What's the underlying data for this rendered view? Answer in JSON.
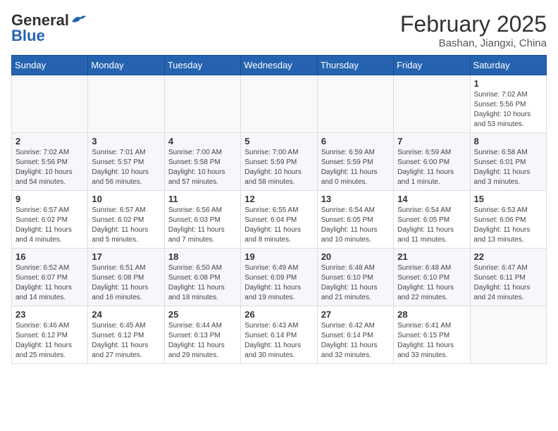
{
  "header": {
    "logo_general": "General",
    "logo_blue": "Blue",
    "month": "February 2025",
    "location": "Bashan, Jiangxi, China"
  },
  "weekdays": [
    "Sunday",
    "Monday",
    "Tuesday",
    "Wednesday",
    "Thursday",
    "Friday",
    "Saturday"
  ],
  "weeks": [
    [
      {
        "day": "",
        "info": ""
      },
      {
        "day": "",
        "info": ""
      },
      {
        "day": "",
        "info": ""
      },
      {
        "day": "",
        "info": ""
      },
      {
        "day": "",
        "info": ""
      },
      {
        "day": "",
        "info": ""
      },
      {
        "day": "1",
        "info": "Sunrise: 7:02 AM\nSunset: 5:56 PM\nDaylight: 10 hours and 53 minutes."
      }
    ],
    [
      {
        "day": "2",
        "info": "Sunrise: 7:02 AM\nSunset: 5:56 PM\nDaylight: 10 hours and 54 minutes."
      },
      {
        "day": "3",
        "info": "Sunrise: 7:01 AM\nSunset: 5:57 PM\nDaylight: 10 hours and 56 minutes."
      },
      {
        "day": "4",
        "info": "Sunrise: 7:00 AM\nSunset: 5:58 PM\nDaylight: 10 hours and 57 minutes."
      },
      {
        "day": "5",
        "info": "Sunrise: 7:00 AM\nSunset: 5:59 PM\nDaylight: 10 hours and 58 minutes."
      },
      {
        "day": "6",
        "info": "Sunrise: 6:59 AM\nSunset: 5:59 PM\nDaylight: 11 hours and 0 minutes."
      },
      {
        "day": "7",
        "info": "Sunrise: 6:59 AM\nSunset: 6:00 PM\nDaylight: 11 hours and 1 minute."
      },
      {
        "day": "8",
        "info": "Sunrise: 6:58 AM\nSunset: 6:01 PM\nDaylight: 11 hours and 3 minutes."
      }
    ],
    [
      {
        "day": "9",
        "info": "Sunrise: 6:57 AM\nSunset: 6:02 PM\nDaylight: 11 hours and 4 minutes."
      },
      {
        "day": "10",
        "info": "Sunrise: 6:57 AM\nSunset: 6:02 PM\nDaylight: 11 hours and 5 minutes."
      },
      {
        "day": "11",
        "info": "Sunrise: 6:56 AM\nSunset: 6:03 PM\nDaylight: 11 hours and 7 minutes."
      },
      {
        "day": "12",
        "info": "Sunrise: 6:55 AM\nSunset: 6:04 PM\nDaylight: 11 hours and 8 minutes."
      },
      {
        "day": "13",
        "info": "Sunrise: 6:54 AM\nSunset: 6:05 PM\nDaylight: 11 hours and 10 minutes."
      },
      {
        "day": "14",
        "info": "Sunrise: 6:54 AM\nSunset: 6:05 PM\nDaylight: 11 hours and 11 minutes."
      },
      {
        "day": "15",
        "info": "Sunrise: 6:53 AM\nSunset: 6:06 PM\nDaylight: 11 hours and 13 minutes."
      }
    ],
    [
      {
        "day": "16",
        "info": "Sunrise: 6:52 AM\nSunset: 6:07 PM\nDaylight: 11 hours and 14 minutes."
      },
      {
        "day": "17",
        "info": "Sunrise: 6:51 AM\nSunset: 6:08 PM\nDaylight: 11 hours and 16 minutes."
      },
      {
        "day": "18",
        "info": "Sunrise: 6:50 AM\nSunset: 6:08 PM\nDaylight: 11 hours and 18 minutes."
      },
      {
        "day": "19",
        "info": "Sunrise: 6:49 AM\nSunset: 6:09 PM\nDaylight: 11 hours and 19 minutes."
      },
      {
        "day": "20",
        "info": "Sunrise: 6:48 AM\nSunset: 6:10 PM\nDaylight: 11 hours and 21 minutes."
      },
      {
        "day": "21",
        "info": "Sunrise: 6:48 AM\nSunset: 6:10 PM\nDaylight: 11 hours and 22 minutes."
      },
      {
        "day": "22",
        "info": "Sunrise: 6:47 AM\nSunset: 6:11 PM\nDaylight: 11 hours and 24 minutes."
      }
    ],
    [
      {
        "day": "23",
        "info": "Sunrise: 6:46 AM\nSunset: 6:12 PM\nDaylight: 11 hours and 25 minutes."
      },
      {
        "day": "24",
        "info": "Sunrise: 6:45 AM\nSunset: 6:12 PM\nDaylight: 11 hours and 27 minutes."
      },
      {
        "day": "25",
        "info": "Sunrise: 6:44 AM\nSunset: 6:13 PM\nDaylight: 11 hours and 29 minutes."
      },
      {
        "day": "26",
        "info": "Sunrise: 6:43 AM\nSunset: 6:14 PM\nDaylight: 11 hours and 30 minutes."
      },
      {
        "day": "27",
        "info": "Sunrise: 6:42 AM\nSunset: 6:14 PM\nDaylight: 11 hours and 32 minutes."
      },
      {
        "day": "28",
        "info": "Sunrise: 6:41 AM\nSunset: 6:15 PM\nDaylight: 11 hours and 33 minutes."
      },
      {
        "day": "",
        "info": ""
      }
    ]
  ]
}
